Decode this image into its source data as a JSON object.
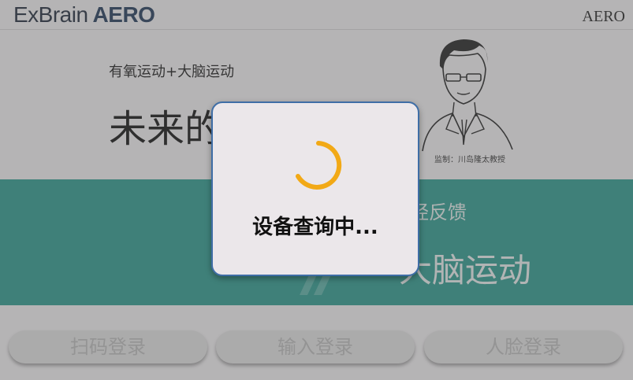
{
  "header": {
    "logo_prefix": "ExBrain",
    "logo_suffix": "AERO",
    "brand_right": "AERO"
  },
  "hero": {
    "subtitle": "有氧运动+大脑运动",
    "headline": "未来的",
    "portrait_caption": "监制：川岛隆太教授"
  },
  "band": {
    "subtitle_visible": "经反馈",
    "main_visible": "大脑运动"
  },
  "login": {
    "scan_label": "扫码登录",
    "input_label": "输入登录",
    "face_label": "人脸登录"
  },
  "dialog": {
    "message": "设备查询中..."
  },
  "colors": {
    "band": "#2c9b90",
    "spinner": "#f2a916",
    "dialog_border": "#3f6ea6"
  }
}
